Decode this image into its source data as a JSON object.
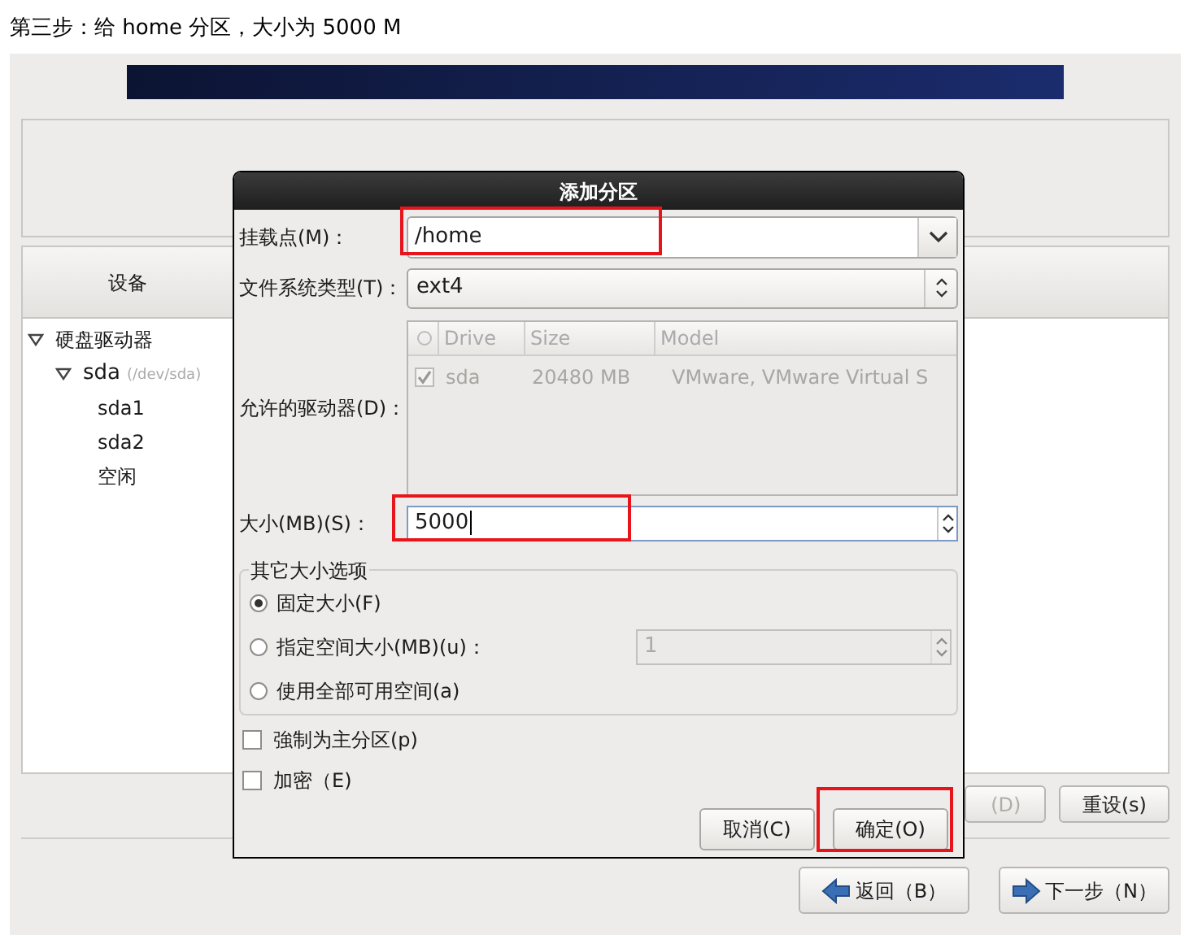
{
  "caption": "第三步：给 home 分区，大小为 5000 M",
  "installer": {
    "device_column": "设备",
    "tree": [
      {
        "label": "硬盘驱动器",
        "expanded": true,
        "children": [
          {
            "label": "sda",
            "note": "(/dev/sda)",
            "expanded": true,
            "children": [
              {
                "label": "sda1"
              },
              {
                "label": "sda2"
              },
              {
                "label": "空闲"
              }
            ]
          }
        ]
      }
    ],
    "table_buttons": [
      {
        "label": "(D)",
        "disabled": true
      },
      {
        "label": "重设(s)",
        "disabled": false
      }
    ],
    "nav_buttons": [
      {
        "label": "返回（B）",
        "kind": "back"
      },
      {
        "label": "下一步（N）",
        "kind": "next"
      }
    ]
  },
  "dialog": {
    "title": "添加分区",
    "mount_point": {
      "label": "挂载点(M)：",
      "value": "/home",
      "highlighted": true
    },
    "fs_type": {
      "label": "文件系统类型(T)：",
      "value": "ext4"
    },
    "drives": {
      "label": "允许的驱动器(D)：",
      "columns": [
        "Drive",
        "Size",
        "Model"
      ],
      "rows": [
        {
          "checked": true,
          "drive": "sda",
          "size": "20480 MB",
          "model": "VMware, VMware Virtual S"
        }
      ]
    },
    "size": {
      "label": "大小(MB)(S)：",
      "value": "5000",
      "highlighted": true
    },
    "size_options": {
      "legend": "其它大小选项",
      "options": [
        {
          "label": "固定大小(F)",
          "selected": true
        },
        {
          "label": "指定空间大小(MB)(u)：",
          "selected": false,
          "spin_value": "1"
        },
        {
          "label": "使用全部可用空间(a)",
          "selected": false
        }
      ]
    },
    "checkboxes": [
      {
        "label": "強制为主分区(p)",
        "checked": false
      },
      {
        "label": "加密（E)",
        "checked": false
      }
    ],
    "buttons": [
      {
        "label": "取消(C)",
        "highlighted": false
      },
      {
        "label": "确定(O)",
        "highlighted": true
      }
    ]
  }
}
